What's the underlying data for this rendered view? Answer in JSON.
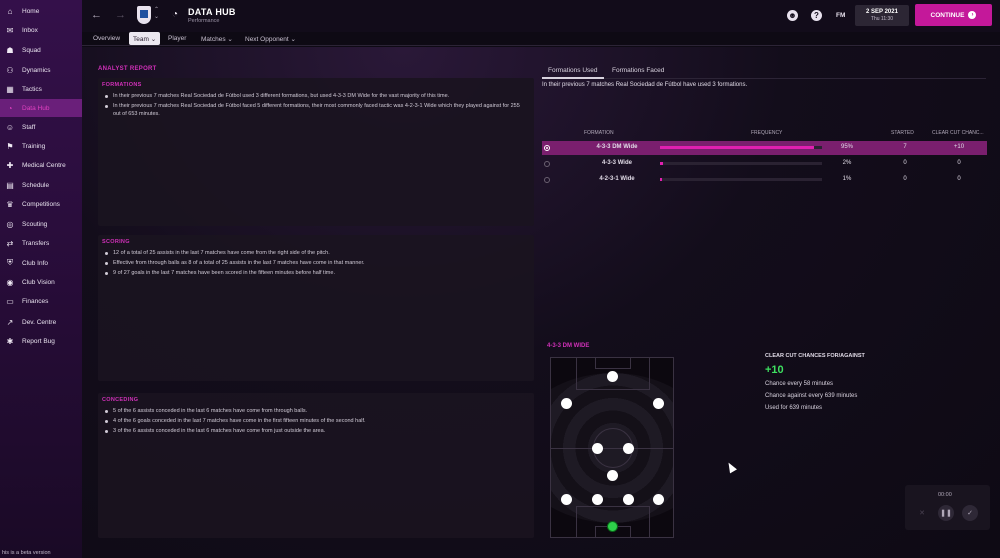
{
  "sidebar": {
    "items": [
      {
        "label": "Home",
        "icon": "home-icon",
        "glyph": "⌂"
      },
      {
        "label": "Inbox",
        "icon": "inbox-icon",
        "glyph": "✉"
      },
      {
        "label": "Squad",
        "icon": "squad-icon",
        "glyph": "☗"
      },
      {
        "label": "Dynamics",
        "icon": "dynamics-icon",
        "glyph": "⚇"
      },
      {
        "label": "Tactics",
        "icon": "tactics-icon",
        "glyph": "▦"
      },
      {
        "label": "Data Hub",
        "icon": "data-hub-icon",
        "glyph": "◔"
      },
      {
        "label": "Staff",
        "icon": "staff-icon",
        "glyph": "☺"
      },
      {
        "label": "Training",
        "icon": "training-icon",
        "glyph": "⚑"
      },
      {
        "label": "Medical Centre",
        "icon": "medical-icon",
        "glyph": "✚"
      },
      {
        "label": "Schedule",
        "icon": "schedule-icon",
        "glyph": "▤"
      },
      {
        "label": "Competitions",
        "icon": "trophy-icon",
        "glyph": "♛"
      },
      {
        "label": "Scouting",
        "icon": "scouting-icon",
        "glyph": "◎"
      },
      {
        "label": "Transfers",
        "icon": "transfers-icon",
        "glyph": "⇄"
      },
      {
        "label": "Club Info",
        "icon": "club-info-icon",
        "glyph": "⛨"
      },
      {
        "label": "Club Vision",
        "icon": "club-vision-icon",
        "glyph": "◉"
      },
      {
        "label": "Finances",
        "icon": "finances-icon",
        "glyph": "▭"
      },
      {
        "label": "Dev. Centre",
        "icon": "dev-centre-icon",
        "glyph": "↗"
      },
      {
        "label": "Report Bug",
        "icon": "bug-icon",
        "glyph": "✱"
      }
    ],
    "active_index": 5,
    "beta_note": "his is a beta version"
  },
  "topbar": {
    "title": "DATA HUB",
    "subtitle": "Performance",
    "fm_label": "FM",
    "date": "2 SEP 2021",
    "time": "Thu 11:30",
    "continue_label": "CONTINUE"
  },
  "tabs": [
    {
      "label": "Overview"
    },
    {
      "label": "Team ⌄"
    },
    {
      "label": "Player"
    },
    {
      "label": "Matches ⌄"
    },
    {
      "label": "Next Opponent ⌄"
    }
  ],
  "analyst": {
    "title": "ANALYST REPORT",
    "formations": {
      "title": "FORMATIONS",
      "bullets": [
        "In their previous 7 matches Real Sociedad de Fútbol used 3 different formations, but used 4-3-3 DM Wide for the vast majority of this time.",
        "In their previous 7 matches Real Sociedad de Fútbol faced 5 different formations, their most commonly faced tactic was 4-2-3-1 Wide which they played against for 255 out of 653 minutes."
      ]
    },
    "scoring": {
      "title": "SCORING",
      "bullets": [
        "12 of a total of 25 assists in the last 7 matches have come from the right side of the pitch.",
        "Effective from through balls as 8 of a total of 25 assists in the last 7 matches have come in that manner.",
        "9 of 27 goals in the last 7 matches have been scored in the fifteen minutes before half time."
      ]
    },
    "conceding": {
      "title": "CONCEDING",
      "bullets": [
        "5 of the 6 assists conceded in the last 6 matches have come from through balls.",
        "4 of the 6 goals conceded in the last 7 matches have come in the first fifteen minutes of the second half.",
        "3 of the 6 assists conceded in the last 6 matches have come from just outside the area."
      ]
    }
  },
  "formations_panel": {
    "tabs": [
      "Formations Used",
      "Formations Faced"
    ],
    "summary": "In their previous 7 matches Real Sociedad de Fútbol have used 3 formations.",
    "headers": {
      "formation": "FORMATION",
      "frequency": "FREQUENCY",
      "started": "STARTED",
      "ccc": "CLEAR CUT CHANC..."
    },
    "rows": [
      {
        "name": "4-3-3 DM Wide",
        "frequency": 0.95,
        "pct_label": "95%",
        "started": "7",
        "ccc": "+10"
      },
      {
        "name": "4-3-3 Wide",
        "frequency": 0.02,
        "pct_label": "2%",
        "started": "0",
        "ccc": "0"
      },
      {
        "name": "4-2-3-1 Wide",
        "frequency": 0.01,
        "pct_label": "1%",
        "started": "0",
        "ccc": "0"
      }
    ]
  },
  "pitch": {
    "title": "4-3-3 DM WIDE"
  },
  "ccc_stats": {
    "title": "CLEAR CUT CHANCES FOR/AGAINST",
    "value": "+10",
    "line1": "Chance every 58 minutes",
    "line2": "Chance against every 639 minutes",
    "line3": "Used for 639 minutes"
  },
  "playback": {
    "time": "00:00"
  },
  "colors": {
    "accent": "#d030b8",
    "continue": "#c4189a",
    "positive": "#3ee060",
    "selected_row": "#7a1f6e"
  }
}
